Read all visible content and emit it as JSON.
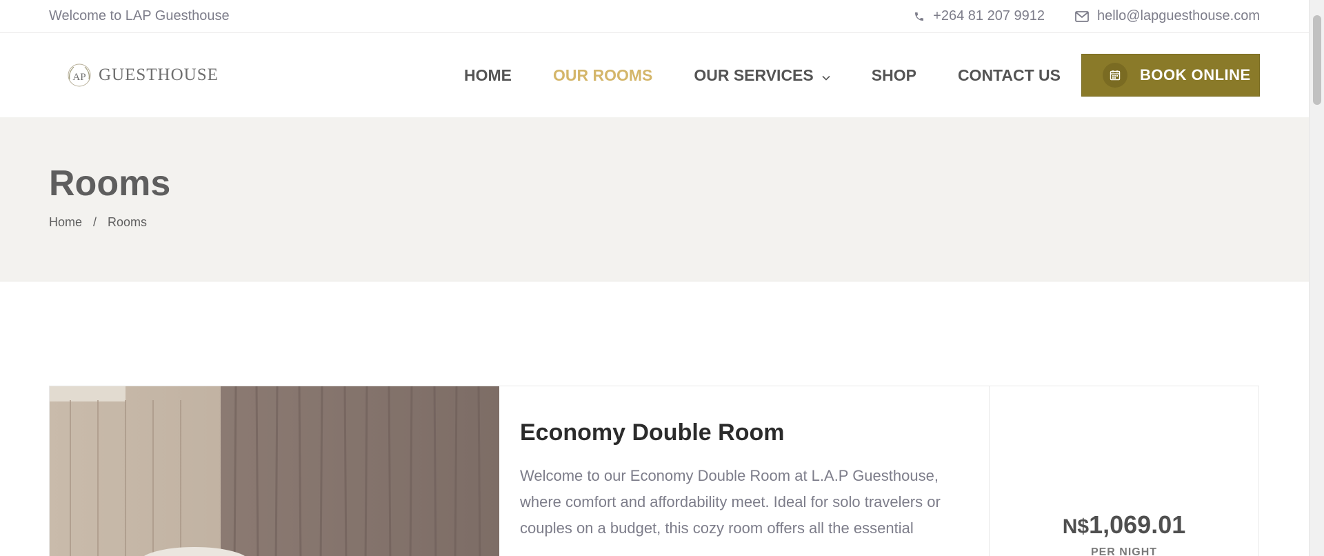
{
  "topbar": {
    "welcome": "Welcome to LAP Guesthouse",
    "phone": "+264 81 207 9912",
    "email": "hello@lapguesthouse.com",
    "phone_icon": "phone-icon",
    "email_icon": "envelope-icon"
  },
  "header": {
    "logo_text": "GUESTHOUSE",
    "logo_monogram": "LAP",
    "nav": [
      {
        "label": "HOME"
      },
      {
        "label": "OUR ROOMS",
        "active": true
      },
      {
        "label": "OUR SERVICES",
        "dropdown": true
      },
      {
        "label": "SHOP"
      },
      {
        "label": "CONTACT US"
      }
    ],
    "book_label": "BOOK ONLINE",
    "book_icon": "calendar-icon"
  },
  "hero": {
    "title": "Rooms",
    "breadcrumb": [
      "Home",
      "/",
      "Rooms"
    ]
  },
  "room": {
    "title": "Economy Double Room",
    "description": "Welcome to our Economy Double Room at L.A.P Guesthouse, where comfort and affordability meet. Ideal for solo travelers or couples on a budget, this cozy room offers all the essential",
    "currency": "N$",
    "price": "1,069.01",
    "per_night": "PER NIGHT"
  },
  "colors": {
    "accent": "#d4b66a",
    "button": "#8a7a29",
    "hero_bg": "#f3f2ef"
  }
}
